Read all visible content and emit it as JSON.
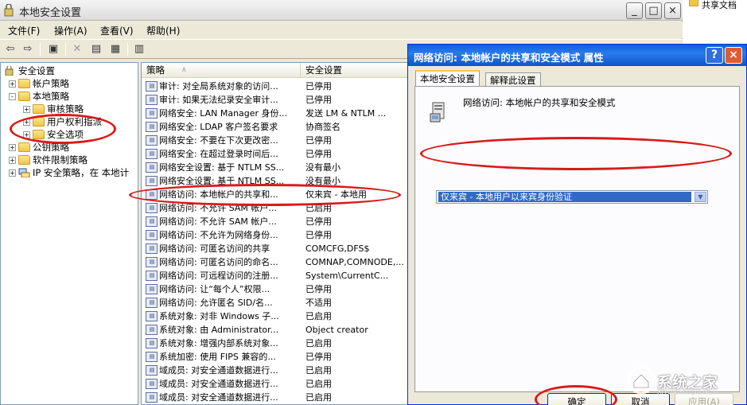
{
  "main_window": {
    "title": "本地安全设置",
    "controls": {
      "minimize": "_",
      "maximize": "□",
      "close": "×"
    }
  },
  "menubar": [
    {
      "label": "文件(F)"
    },
    {
      "label": "操作(A)"
    },
    {
      "label": "查看(V)"
    },
    {
      "label": "帮助(H)"
    }
  ],
  "tree": [
    {
      "label": "安全设置",
      "icon": "security-settings-icon"
    },
    {
      "label": "帐户策略",
      "icon": "folder-icon",
      "expander": "+"
    },
    {
      "label": "本地策略",
      "icon": "folder-icon",
      "expander": "-"
    },
    {
      "label": "审核策略",
      "icon": "folder-icon",
      "expander": "+"
    },
    {
      "label": "用户权利指派",
      "icon": "folder-icon",
      "expander": "+"
    },
    {
      "label": "安全选项",
      "icon": "folder-open-icon",
      "expander": "+"
    },
    {
      "label": "公钥策略",
      "icon": "folder-icon",
      "expander": "+"
    },
    {
      "label": "软件限制策略",
      "icon": "folder-icon",
      "expander": "+"
    },
    {
      "label": "IP 安全策略，在 本地计",
      "icon": "ip-security-icon",
      "expander": "+"
    }
  ],
  "list": {
    "columns": [
      "策略",
      "安全设置"
    ],
    "rows": [
      [
        "审计: 对全局系统对象的访问...",
        "已停用"
      ],
      [
        "审计: 如果无法纪录安全审计...",
        "已停用"
      ],
      [
        "网络安全: LAN Manager 身份...",
        "发送 LM & NTLM ..."
      ],
      [
        "网络安全: LDAP 客户签名要求",
        "协商签名"
      ],
      [
        "网络安全: 不要在下次更改密...",
        "已停用"
      ],
      [
        "网络安全: 在超过登录时间后...",
        "已停用"
      ],
      [
        "网络安全设置: 基于 NTLM SS...",
        "没有最小"
      ],
      [
        "网络安全设置: 基于 NTLM SS...",
        "没有最小"
      ],
      [
        "网络访问: 本地帐户的共享和...",
        "仅来宾 - 本地用"
      ],
      [
        "网络访问: 不允许 SAM 帐户...",
        "已启用"
      ],
      [
        "网络访问: 不允许 SAM 帐户...",
        "已停用"
      ],
      [
        "网络访问: 不允许为网络身份...",
        "已停用"
      ],
      [
        "网络访问: 可匿名访问的共享",
        "COMCFG,DFS$"
      ],
      [
        "网络访问: 可匿名访问的命名...",
        "COMNAP,COMNODE,..."
      ],
      [
        "网络访问: 可远程访问的注册...",
        "System\\CurrentC..."
      ],
      [
        "网络访问: 让“每个人”权限...",
        "已停用"
      ],
      [
        "网络访问: 允许匿名 SID/名...",
        "不适用"
      ],
      [
        "系统对象: 对非 Windows 子...",
        "已启用"
      ],
      [
        "系统对象: 由 Administrator...",
        "Object creator"
      ],
      [
        "系统对象: 增强内部系统对象...",
        "已启用"
      ],
      [
        "系统加密: 使用 FIPS 兼容的...",
        "已停用"
      ],
      [
        "域成员: 对安全通道数据进行...",
        "已启用"
      ],
      [
        "域成员: 对安全通道数据进行...",
        "已启用"
      ],
      [
        "域成员: 对安全通道数据进行...",
        "已启用"
      ]
    ]
  },
  "dialog": {
    "title": "网络访问: 本地帐户的共享和安全模式  属性",
    "help": "?",
    "close": "×",
    "tabs": [
      "本地安全设置",
      "解释此设置"
    ],
    "policy_label": "网络访问: 本地帐户的共享和安全模式",
    "selected_value": "仅来宾 - 本地用户以来宾身份验证",
    "buttons": {
      "ok": "确定",
      "cancel": "取消",
      "apply": "应用(A)"
    }
  },
  "shared_doc": "共享文档",
  "watermark": {
    "text": "系统之家",
    "url": "XITONGZHIJIA.NET"
  },
  "annotation_color": "#d81b1b"
}
